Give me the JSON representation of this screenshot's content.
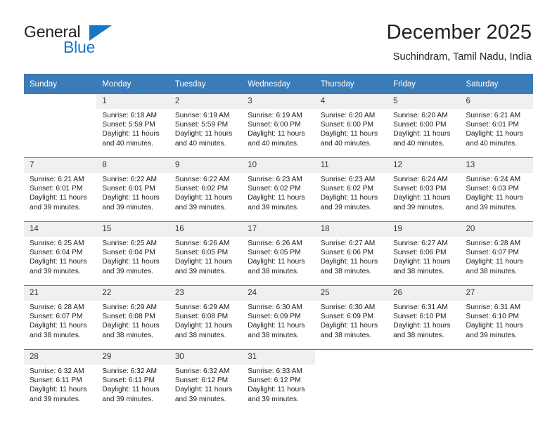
{
  "brand": {
    "name_part1": "General",
    "name_part2": "Blue",
    "triangle_color": "#1877c4"
  },
  "header": {
    "title": "December 2025",
    "subtitle": "Suchindram, Tamil Nadu, India",
    "accent_color": "#3b7cb8",
    "daynum_band_color": "#f0f0f0"
  },
  "weekdays": [
    "Sunday",
    "Monday",
    "Tuesday",
    "Wednesday",
    "Thursday",
    "Friday",
    "Saturday"
  ],
  "weeks": [
    [
      {
        "day": "",
        "lines": []
      },
      {
        "day": "1",
        "lines": [
          "Sunrise: 6:18 AM",
          "Sunset: 5:59 PM",
          "Daylight: 11 hours",
          "and 40 minutes."
        ]
      },
      {
        "day": "2",
        "lines": [
          "Sunrise: 6:19 AM",
          "Sunset: 5:59 PM",
          "Daylight: 11 hours",
          "and 40 minutes."
        ]
      },
      {
        "day": "3",
        "lines": [
          "Sunrise: 6:19 AM",
          "Sunset: 6:00 PM",
          "Daylight: 11 hours",
          "and 40 minutes."
        ]
      },
      {
        "day": "4",
        "lines": [
          "Sunrise: 6:20 AM",
          "Sunset: 6:00 PM",
          "Daylight: 11 hours",
          "and 40 minutes."
        ]
      },
      {
        "day": "5",
        "lines": [
          "Sunrise: 6:20 AM",
          "Sunset: 6:00 PM",
          "Daylight: 11 hours",
          "and 40 minutes."
        ]
      },
      {
        "day": "6",
        "lines": [
          "Sunrise: 6:21 AM",
          "Sunset: 6:01 PM",
          "Daylight: 11 hours",
          "and 40 minutes."
        ]
      }
    ],
    [
      {
        "day": "7",
        "lines": [
          "Sunrise: 6:21 AM",
          "Sunset: 6:01 PM",
          "Daylight: 11 hours",
          "and 39 minutes."
        ]
      },
      {
        "day": "8",
        "lines": [
          "Sunrise: 6:22 AM",
          "Sunset: 6:01 PM",
          "Daylight: 11 hours",
          "and 39 minutes."
        ]
      },
      {
        "day": "9",
        "lines": [
          "Sunrise: 6:22 AM",
          "Sunset: 6:02 PM",
          "Daylight: 11 hours",
          "and 39 minutes."
        ]
      },
      {
        "day": "10",
        "lines": [
          "Sunrise: 6:23 AM",
          "Sunset: 6:02 PM",
          "Daylight: 11 hours",
          "and 39 minutes."
        ]
      },
      {
        "day": "11",
        "lines": [
          "Sunrise: 6:23 AM",
          "Sunset: 6:02 PM",
          "Daylight: 11 hours",
          "and 39 minutes."
        ]
      },
      {
        "day": "12",
        "lines": [
          "Sunrise: 6:24 AM",
          "Sunset: 6:03 PM",
          "Daylight: 11 hours",
          "and 39 minutes."
        ]
      },
      {
        "day": "13",
        "lines": [
          "Sunrise: 6:24 AM",
          "Sunset: 6:03 PM",
          "Daylight: 11 hours",
          "and 39 minutes."
        ]
      }
    ],
    [
      {
        "day": "14",
        "lines": [
          "Sunrise: 6:25 AM",
          "Sunset: 6:04 PM",
          "Daylight: 11 hours",
          "and 39 minutes."
        ]
      },
      {
        "day": "15",
        "lines": [
          "Sunrise: 6:25 AM",
          "Sunset: 6:04 PM",
          "Daylight: 11 hours",
          "and 39 minutes."
        ]
      },
      {
        "day": "16",
        "lines": [
          "Sunrise: 6:26 AM",
          "Sunset: 6:05 PM",
          "Daylight: 11 hours",
          "and 39 minutes."
        ]
      },
      {
        "day": "17",
        "lines": [
          "Sunrise: 6:26 AM",
          "Sunset: 6:05 PM",
          "Daylight: 11 hours",
          "and 38 minutes."
        ]
      },
      {
        "day": "18",
        "lines": [
          "Sunrise: 6:27 AM",
          "Sunset: 6:06 PM",
          "Daylight: 11 hours",
          "and 38 minutes."
        ]
      },
      {
        "day": "19",
        "lines": [
          "Sunrise: 6:27 AM",
          "Sunset: 6:06 PM",
          "Daylight: 11 hours",
          "and 38 minutes."
        ]
      },
      {
        "day": "20",
        "lines": [
          "Sunrise: 6:28 AM",
          "Sunset: 6:07 PM",
          "Daylight: 11 hours",
          "and 38 minutes."
        ]
      }
    ],
    [
      {
        "day": "21",
        "lines": [
          "Sunrise: 6:28 AM",
          "Sunset: 6:07 PM",
          "Daylight: 11 hours",
          "and 38 minutes."
        ]
      },
      {
        "day": "22",
        "lines": [
          "Sunrise: 6:29 AM",
          "Sunset: 6:08 PM",
          "Daylight: 11 hours",
          "and 38 minutes."
        ]
      },
      {
        "day": "23",
        "lines": [
          "Sunrise: 6:29 AM",
          "Sunset: 6:08 PM",
          "Daylight: 11 hours",
          "and 38 minutes."
        ]
      },
      {
        "day": "24",
        "lines": [
          "Sunrise: 6:30 AM",
          "Sunset: 6:09 PM",
          "Daylight: 11 hours",
          "and 38 minutes."
        ]
      },
      {
        "day": "25",
        "lines": [
          "Sunrise: 6:30 AM",
          "Sunset: 6:09 PM",
          "Daylight: 11 hours",
          "and 38 minutes."
        ]
      },
      {
        "day": "26",
        "lines": [
          "Sunrise: 6:31 AM",
          "Sunset: 6:10 PM",
          "Daylight: 11 hours",
          "and 38 minutes."
        ]
      },
      {
        "day": "27",
        "lines": [
          "Sunrise: 6:31 AM",
          "Sunset: 6:10 PM",
          "Daylight: 11 hours",
          "and 39 minutes."
        ]
      }
    ],
    [
      {
        "day": "28",
        "lines": [
          "Sunrise: 6:32 AM",
          "Sunset: 6:11 PM",
          "Daylight: 11 hours",
          "and 39 minutes."
        ]
      },
      {
        "day": "29",
        "lines": [
          "Sunrise: 6:32 AM",
          "Sunset: 6:11 PM",
          "Daylight: 11 hours",
          "and 39 minutes."
        ]
      },
      {
        "day": "30",
        "lines": [
          "Sunrise: 6:32 AM",
          "Sunset: 6:12 PM",
          "Daylight: 11 hours",
          "and 39 minutes."
        ]
      },
      {
        "day": "31",
        "lines": [
          "Sunrise: 6:33 AM",
          "Sunset: 6:12 PM",
          "Daylight: 11 hours",
          "and 39 minutes."
        ]
      },
      {
        "day": "",
        "lines": []
      },
      {
        "day": "",
        "lines": []
      },
      {
        "day": "",
        "lines": []
      }
    ]
  ]
}
